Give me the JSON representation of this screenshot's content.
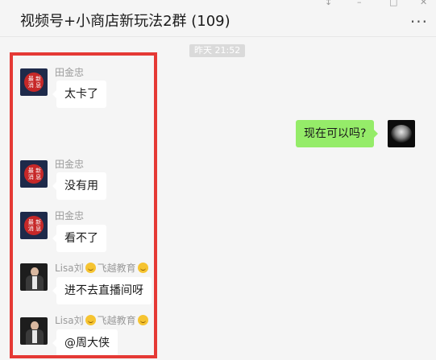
{
  "window": {
    "title": "视频号+小商店新玩法2群 (109)",
    "more_label": "···",
    "controls": [
      "↕",
      "–",
      "□",
      "✕"
    ]
  },
  "chat": {
    "timestamp": "昨天 21:52",
    "messages": [
      {
        "sender": "田金忠",
        "text": "太卡了",
        "avatar": "news-avatar"
      },
      {
        "self": true,
        "text": "现在可以吗?",
        "avatar": "self-avatar"
      },
      {
        "sender": "田金忠",
        "text": "没有用",
        "avatar": "news-avatar"
      },
      {
        "sender": "田金忠",
        "text": "看不了",
        "avatar": "news-avatar"
      },
      {
        "sender_name": "Lisa刘",
        "sender_tag": "飞越教育",
        "text": "进不去直播间呀",
        "avatar": "lisa-avatar"
      },
      {
        "sender_name": "Lisa刘",
        "sender_tag": "飞越教育",
        "text": "@周大侠",
        "avatar": "lisa-avatar"
      }
    ],
    "news_avatar_text": "最新\n消息"
  },
  "colors": {
    "background": "#f5f5f5",
    "self_bubble": "#95ec69",
    "other_bubble": "#ffffff",
    "highlight": "#e53935"
  }
}
